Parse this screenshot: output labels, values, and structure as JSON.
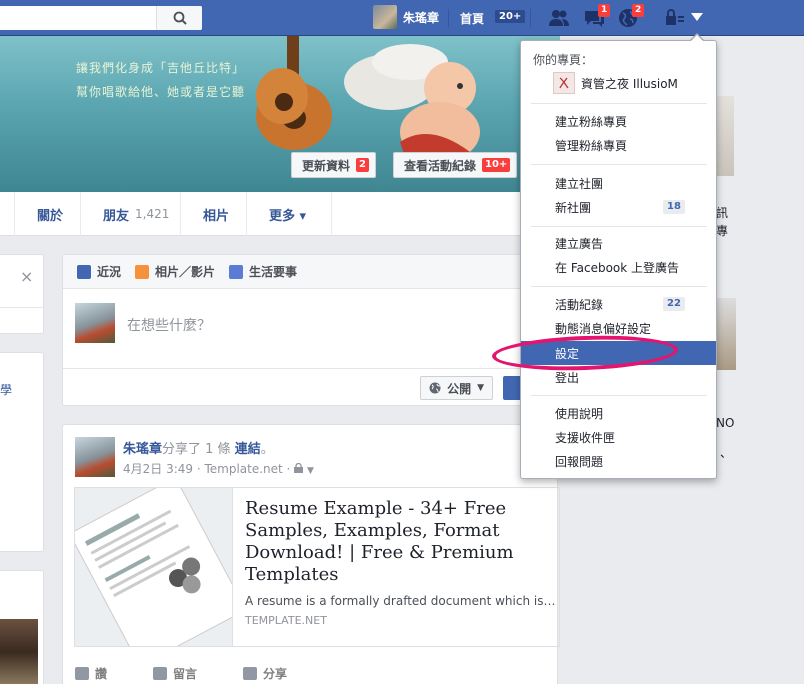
{
  "topbar": {
    "user_name": "朱瑤章",
    "home_label": "首頁",
    "home_badge": "20+",
    "friend_icon": "friends-icon",
    "messages_badge": "1",
    "notifications_badge": "2",
    "colors": {
      "bar": "#4267b2",
      "badge": "#fa3e3e"
    }
  },
  "cover": {
    "text_line1": "讓我們化身成「吉他丘比特」",
    "text_line2": "幫你唱歌給他、她或者是它聽",
    "update_label": "更新資料",
    "update_badge": "2",
    "activity_label": "查看活動紀錄",
    "activity_badge": "10+"
  },
  "tabs": {
    "about": "關於",
    "friends": "朋友",
    "friends_count": "1,421",
    "photos": "相片",
    "more": "更多 ▾"
  },
  "left": {
    "close": "×",
    "snippet": "學"
  },
  "composer": {
    "tab_status": "近況",
    "tab_photo": "相片／影片",
    "tab_life": "生活要事",
    "placeholder": "在想些什麼？",
    "privacy": "公開"
  },
  "post": {
    "author": "朱瑤章",
    "shared_text": "分享了 1 條",
    "link_word": "連結",
    "period": "。",
    "meta": "4月2日 3:49 · Template.net · ",
    "link_title": "Resume Example - 34+ Free Samples, Examples, Format Download! | Free & Premium Templates",
    "link_desc": "A resume is a formally drafted document which is…",
    "link_domain": "TEMPLATE.NET",
    "like": "讚",
    "comment": "留言",
    "share": "分享"
  },
  "right": {
    "frag1": "訊",
    "frag2": "專",
    "frag3": "NO",
    "frag4": "、"
  },
  "dropdown": {
    "heading": "你的專頁：",
    "page_name": "資管之夜 IllusioM",
    "items": [
      "建立粉絲專頁",
      "管理粉絲專頁",
      "建立社團",
      "新社團",
      "建立廣告",
      "在 Facebook 上登廣告",
      "活動紀錄",
      "動態消息偏好設定",
      "設定",
      "登出",
      "使用說明",
      "支援收件匣",
      "回報問題"
    ],
    "new_groups_count": "18",
    "activity_count": "22"
  }
}
